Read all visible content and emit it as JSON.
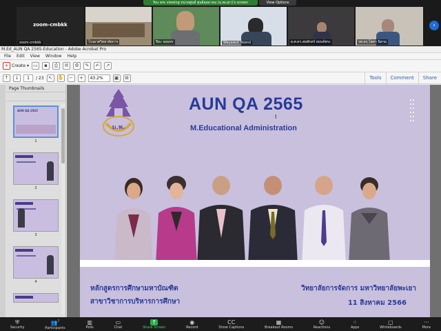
{
  "zoom": {
    "banner_text": "You are viewing หน่วยศูนย์ ศูนย์ดุลลาคม (ม.พะเยา)'s screen",
    "view_options": "View Options",
    "gallery": [
      {
        "name": "zoom-cmbkk",
        "big_label": "zoom-cmbkk"
      },
      {
        "name": "โรงมาศวิทยาลัยการ"
      },
      {
        "name": "ปิยะ จอมทร"
      },
      {
        "name": "Wayawut Yoonsi"
      },
      {
        "name": "ผ.ศ.ดร.สมพักตร์ ผ่อนจ์พระ"
      },
      {
        "name": "รศ.ดร.โสดา นิสาม"
      }
    ],
    "toolbar": [
      {
        "label": "Security",
        "icon": "shield-icon",
        "glyph": "⛨"
      },
      {
        "label": "Participants",
        "icon": "participants-icon",
        "glyph": "👥",
        "count": "7"
      },
      {
        "label": "Polls",
        "icon": "polls-icon",
        "glyph": "▥"
      },
      {
        "label": "Chat",
        "icon": "chat-icon",
        "glyph": "▭"
      },
      {
        "label": "Share Screen",
        "icon": "share-screen-icon",
        "glyph": "↑"
      },
      {
        "label": "Record",
        "icon": "record-icon",
        "glyph": "◉"
      },
      {
        "label": "Show Captions",
        "icon": "captions-icon",
        "glyph": "CC"
      },
      {
        "label": "Breakout Rooms",
        "icon": "breakout-rooms-icon",
        "glyph": "▦"
      },
      {
        "label": "Reactions",
        "icon": "reactions-icon",
        "glyph": "☺"
      },
      {
        "label": "Apps",
        "icon": "apps-icon",
        "glyph": "⁘"
      },
      {
        "label": "Whiteboards",
        "icon": "whiteboard-icon",
        "glyph": "▢"
      },
      {
        "label": "More",
        "icon": "more-icon",
        "glyph": "···"
      }
    ]
  },
  "acrobat": {
    "title": "M.Ed_AUN QA 2565-Education - Adobe Acrobat Pro",
    "menu": [
      "File",
      "Edit",
      "View",
      "Window",
      "Help"
    ],
    "create_label": "Create",
    "page_current": "1",
    "page_total": "/ 23",
    "zoom_level": "43.2%",
    "right_tabs": [
      "Tools",
      "Comment",
      "Share"
    ],
    "sidebar_title": "Page Thumbnails",
    "thumb_labels": [
      "1",
      "2",
      "3",
      "4"
    ]
  },
  "slide": {
    "title": "AUN QA 2565",
    "subtitle": "M.Educational Administration",
    "program_line1": "หลักสูตรการศึกษามหาบัณฑิต",
    "program_line2": "สาขาวิชาการบริหารการศึกษา",
    "college": "วิทยาลัยการจัดการ มหาวิทยาลัยพะเยา",
    "date": "11 สิงหาคม 2566",
    "colors": {
      "title": "#283b96",
      "background": "#c9c0de"
    }
  }
}
